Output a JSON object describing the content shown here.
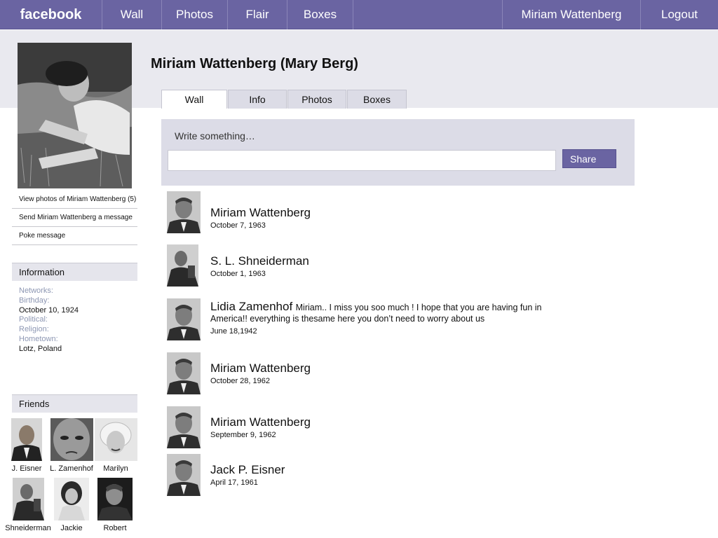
{
  "nav": {
    "logo": "facebook",
    "wall": "Wall",
    "photos": "Photos",
    "flair": "Flair",
    "boxes": "Boxes",
    "user": "Miriam Wattenberg",
    "logout": "Logout"
  },
  "profile": {
    "title": "Miriam Wattenberg (Mary Berg)",
    "links": {
      "view_photos": "View photos of Miriam Wattenberg (5)",
      "send_message": "Send Miriam Wattenberg a message",
      "poke": "Poke message"
    }
  },
  "tabs": {
    "wall": "Wall",
    "info": "Info",
    "photos": "Photos",
    "boxes": "Boxes"
  },
  "information": {
    "heading": "Information",
    "networks_label": "Networks:",
    "birthday_label": "Birthday:",
    "birthday_value": "October 10, 1924",
    "political_label": "Political:",
    "religion_label": "Religion:",
    "hometown_label": "Hometown:",
    "hometown_value": "Lotz, Poland"
  },
  "friends": {
    "heading": "Friends",
    "list": [
      {
        "name": "J. Eisner"
      },
      {
        "name": "L. Zamenhof"
      },
      {
        "name": "Marilyn"
      },
      {
        "name": "Shneiderman"
      },
      {
        "name": "Jackie"
      },
      {
        "name": "Robert"
      }
    ]
  },
  "composer": {
    "prompt": "Write something…",
    "placeholder": "",
    "share_label": "Share"
  },
  "posts": [
    {
      "author": "Miriam Wattenberg",
      "message": "",
      "date": "October 7, 1963"
    },
    {
      "author": "S. L. Shneiderman",
      "message": "",
      "date": "October 1, 1963"
    },
    {
      "author": "Lidia Zamenhof",
      "message": "Miriam.. I miss you soo much ! I hope that you are having fun in America!! everything is thesame here you don’t need to worry about us",
      "date": "June 18,1942"
    },
    {
      "author": "Miriam Wattenberg",
      "message": "",
      "date": "October 28, 1962"
    },
    {
      "author": "Miriam Wattenberg",
      "message": "",
      "date": "September 9, 1962"
    },
    {
      "author": "Jack P. Eisner",
      "message": "",
      "date": "April 17, 1961"
    }
  ]
}
